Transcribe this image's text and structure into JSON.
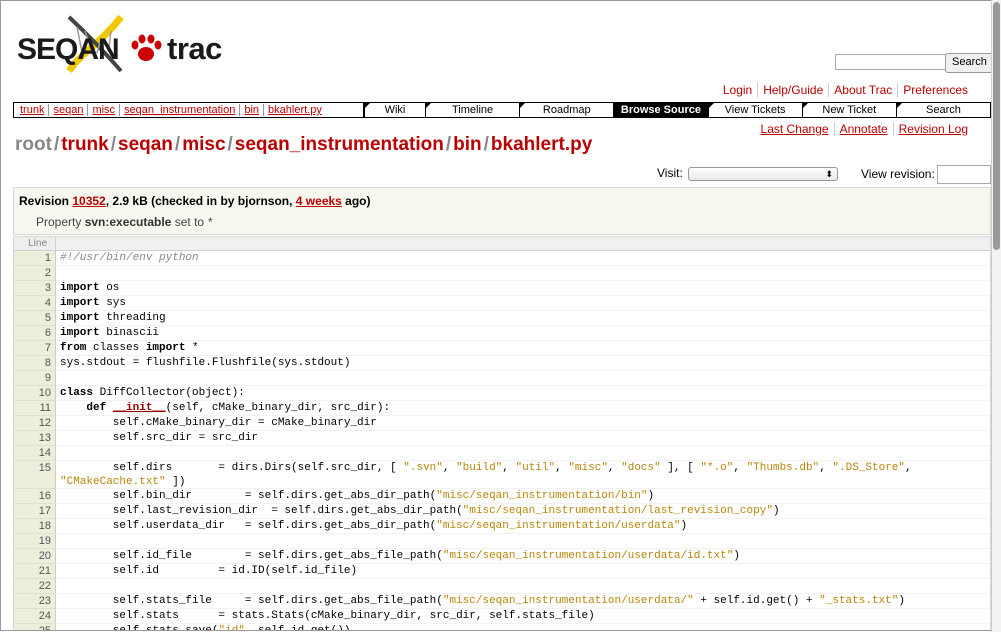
{
  "logo": {
    "seqan_text": "SEQAN",
    "trac_text": "trac"
  },
  "search": {
    "button_label": "Search",
    "placeholder": ""
  },
  "metanav": [
    "Login",
    "Help/Guide",
    "About Trac",
    "Preferences"
  ],
  "breadcrumbs": [
    "trunk",
    "seqan",
    "misc",
    "seqan_instrumentation",
    "bin",
    "bkahlert.py"
  ],
  "mainnav": [
    {
      "label": "Wiki",
      "active": false
    },
    {
      "label": "Timeline",
      "active": false
    },
    {
      "label": "Roadmap",
      "active": false
    },
    {
      "label": "Browse Source",
      "active": true
    },
    {
      "label": "View Tickets",
      "active": false
    },
    {
      "label": "New Ticket",
      "active": false
    },
    {
      "label": "Search",
      "active": false
    }
  ],
  "ctxnav": [
    "Last Change",
    "Annotate",
    "Revision Log"
  ],
  "path": {
    "root": "root",
    "segments": [
      "trunk",
      "seqan",
      "misc",
      "seqan_instrumentation",
      "bin",
      "bkahlert.py"
    ]
  },
  "visit": {
    "label": "Visit:",
    "selected": ""
  },
  "view_revision": {
    "label": "View revision:",
    "value": ""
  },
  "info": {
    "revision_prefix": "Revision ",
    "revision": "10352",
    "size_text": ", 2.9 kB (checked in by bjornson, ",
    "age": "4 weeks",
    "age_suffix": " ago)",
    "property_prefix": "Property ",
    "property_name": "svn:executable",
    "property_suffix": " set to ",
    "property_value": "*"
  },
  "code": {
    "header_label": "Line",
    "lines": [
      {
        "n": "1",
        "html": "<span class=\"cm\">#!/usr/bin/env python</span>"
      },
      {
        "n": "2",
        "html": ""
      },
      {
        "n": "3",
        "html": "<span class=\"kw\">import</span> os"
      },
      {
        "n": "4",
        "html": "<span class=\"kw\">import</span> sys"
      },
      {
        "n": "5",
        "html": "<span class=\"kw\">import</span> threading"
      },
      {
        "n": "6",
        "html": "<span class=\"kw\">import</span> binascii"
      },
      {
        "n": "7",
        "html": "<span class=\"kw\">from</span> classes <span class=\"kw\">import</span> *"
      },
      {
        "n": "8",
        "html": "sys.stdout = flushfile.Flushfile(sys.stdout)"
      },
      {
        "n": "9",
        "html": ""
      },
      {
        "n": "10",
        "html": "<span class=\"kw\">class</span> DiffCollector(object):"
      },
      {
        "n": "11",
        "html": "    <span class=\"kw\">def</span> <span class=\"fn\">__init__</span>(self, cMake_binary_dir, src_dir):"
      },
      {
        "n": "12",
        "html": "        self.cMake_binary_dir = cMake_binary_dir"
      },
      {
        "n": "13",
        "html": "        self.src_dir = src_dir"
      },
      {
        "n": "14",
        "html": ""
      },
      {
        "n": "15",
        "tall": true,
        "html": "        self.dirs       = dirs.Dirs(self.src_dir, [ <span class=\"st\">\".svn\"</span>, <span class=\"st\">\"build\"</span>, <span class=\"st\">\"util\"</span>, <span class=\"st\">\"misc\"</span>, <span class=\"st\">\"docs\"</span> ], [ <span class=\"st\">\"*.o\"</span>, <span class=\"st\">\"Thumbs.db\"</span>, <span class=\"st\">\".DS_Store\"</span>,\n<span class=\"st\">\"CMakeCache.txt\"</span> ])"
      },
      {
        "n": "16",
        "html": "        self.bin_dir        = self.dirs.get_abs_dir_path(<span class=\"st\">\"misc/seqan_instrumentation/bin\"</span>)"
      },
      {
        "n": "17",
        "html": "        self.last_revision_dir  = self.dirs.get_abs_dir_path(<span class=\"st\">\"misc/seqan_instrumentation/last_revision_copy\"</span>)"
      },
      {
        "n": "18",
        "html": "        self.userdata_dir   = self.dirs.get_abs_dir_path(<span class=\"st\">\"misc/seqan_instrumentation/userdata\"</span>)"
      },
      {
        "n": "19",
        "html": ""
      },
      {
        "n": "20",
        "html": "        self.id_file        = self.dirs.get_abs_file_path(<span class=\"st\">\"misc/seqan_instrumentation/userdata/id.txt\"</span>)"
      },
      {
        "n": "21",
        "html": "        self.id         = id.ID(self.id_file)"
      },
      {
        "n": "22",
        "html": ""
      },
      {
        "n": "23",
        "html": "        self.stats_file     = self.dirs.get_abs_file_path(<span class=\"st\">\"misc/seqan_instrumentation/userdata/\"</span> + self.id.get() + <span class=\"st\">\"_stats.txt\"</span>)"
      },
      {
        "n": "24",
        "html": "        self.stats      = stats.Stats(cMake_binary_dir, src_dir, self.stats_file)"
      },
      {
        "n": "25",
        "html": "        self.stats.save(<span class=\"st\">\"id\"</span>, self.id.get())"
      }
    ]
  }
}
